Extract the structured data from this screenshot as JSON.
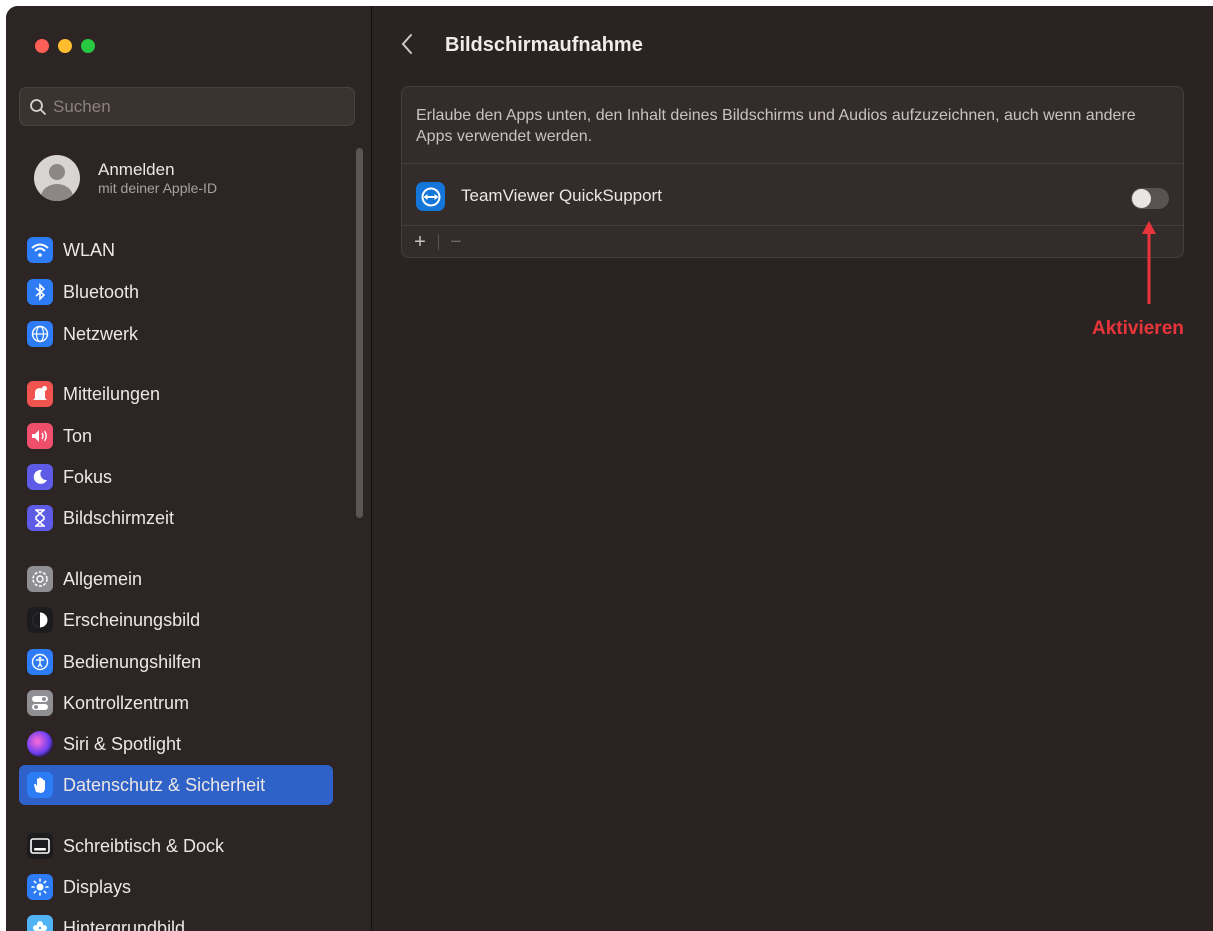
{
  "search": {
    "placeholder": "Suchen"
  },
  "account": {
    "title": "Anmelden",
    "subtitle": "mit deiner Apple-ID"
  },
  "sidebar": {
    "items": [
      {
        "label": "WLAN",
        "icon": "wifi-icon",
        "color": "#2d7cf6"
      },
      {
        "label": "Bluetooth",
        "icon": "bluetooth-icon",
        "color": "#2d7cf6"
      },
      {
        "label": "Netzwerk",
        "icon": "globe-icon",
        "color": "#2d7cf6"
      },
      {
        "label": "Mitteilungen",
        "icon": "bell-icon",
        "color": "#f0544f"
      },
      {
        "label": "Ton",
        "icon": "speaker-icon",
        "color": "#f04f6b"
      },
      {
        "label": "Fokus",
        "icon": "moon-icon",
        "color": "#5e5ce6"
      },
      {
        "label": "Bildschirmzeit",
        "icon": "hourglass-icon",
        "color": "#5e5ce6"
      },
      {
        "label": "Allgemein",
        "icon": "gear-icon",
        "color": "#8e8e93"
      },
      {
        "label": "Erscheinungsbild",
        "icon": "appearance-icon",
        "color": "#1c1c1e"
      },
      {
        "label": "Bedienungshilfen",
        "icon": "accessibility-icon",
        "color": "#2d7cf6"
      },
      {
        "label": "Kontrollzentrum",
        "icon": "switches-icon",
        "color": "#8e8e93"
      },
      {
        "label": "Siri & Spotlight",
        "icon": "siri-icon",
        "color": "#b04adf"
      },
      {
        "label": "Datenschutz & Sicherheit",
        "icon": "hand-icon",
        "color": "#2d7cf6",
        "active": true
      },
      {
        "label": "Schreibtisch & Dock",
        "icon": "dock-icon",
        "color": "#1c1c1e"
      },
      {
        "label": "Displays",
        "icon": "sun-icon",
        "color": "#2d7cf6"
      },
      {
        "label": "Hintergrundbild",
        "icon": "flower-icon",
        "color": "#4fb3f6"
      }
    ]
  },
  "main": {
    "title": "Bildschirmaufnahme",
    "description": "Erlaube den Apps unten, den Inhalt deines Bildschirms und Audios aufzuzeichnen, auch wenn andere Apps verwendet werden.",
    "apps": [
      {
        "name": "TeamViewer QuickSupport",
        "enabled": false
      }
    ],
    "add_label": "+",
    "remove_label": "−"
  },
  "annotation": {
    "label": "Aktivieren",
    "color": "#e8353b"
  }
}
